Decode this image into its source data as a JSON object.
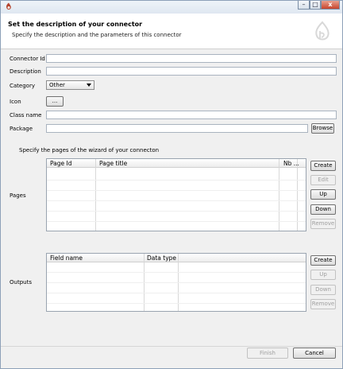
{
  "window": {
    "minimize_glyph": "–",
    "maximize_glyph": "□",
    "close_glyph": "x"
  },
  "header": {
    "title": "Set the description of your connector",
    "subtitle": "Specify the description and the parameters of this connector"
  },
  "form": {
    "connector_id_label": "Connector Id",
    "connector_id_value": "",
    "description_label": "Description",
    "description_value": "",
    "category_label": "Category",
    "category_value": "Other",
    "icon_label": "Icon",
    "icon_button": "...",
    "class_name_label": "Class name",
    "class_name_value": "",
    "package_label": "Package",
    "package_value": "",
    "browse_button": "Browse"
  },
  "pages": {
    "instructions": "Specify the pages of the wizard of your connecton",
    "section_label": "Pages",
    "columns": [
      "Page Id",
      "Page title",
      "Nb ..."
    ],
    "rows": [],
    "buttons": {
      "create": "Create",
      "edit": "Edit",
      "up": "Up",
      "down": "Down",
      "remove": "Remove"
    }
  },
  "outputs": {
    "section_label": "Outputs",
    "columns": [
      "Field name",
      "Data type",
      ""
    ],
    "rows": [],
    "buttons": {
      "create": "Create",
      "up": "Up",
      "down": "Down",
      "remove": "Remove"
    }
  },
  "footer": {
    "finish": "Finish",
    "cancel": "Cancel"
  },
  "colors": {
    "accent": "#c7442c",
    "panel": "#f0f0f0"
  }
}
